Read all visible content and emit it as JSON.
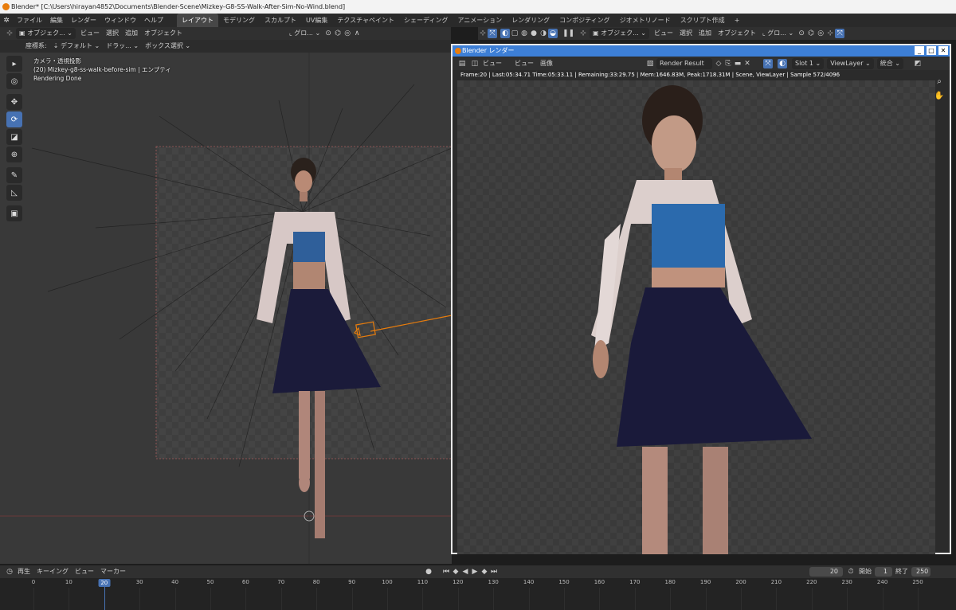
{
  "window": {
    "title": "Blender* [C:\\Users\\hirayan4852\\Documents\\Blender-Scene\\Mizkey-G8-SS-Walk-After-Sim-No-Wind.blend]"
  },
  "menu": [
    "ファイル",
    "編集",
    "レンダー",
    "ウィンドウ",
    "ヘルプ"
  ],
  "workspaces": [
    "レイアウト",
    "モデリング",
    "スカルプト",
    "UV編集",
    "テクスチャペイント",
    "シェーディング",
    "アニメーション",
    "レンダリング",
    "コンポジティング",
    "ジオメトリノード",
    "スクリプト作成",
    "+"
  ],
  "viewport_header": {
    "mode": "オブジェク...",
    "items": [
      "ビュー",
      "選択",
      "追加",
      "オブジェクト"
    ],
    "transform": "グロ...",
    "coords_label": "座標系:",
    "coords_value": "デフォルト",
    "drag_value": "ドラッ...",
    "select_mode": "ボックス選択"
  },
  "right_header": {
    "mode": "オブジェク...",
    "items": [
      "ビュー",
      "選択",
      "追加",
      "オブジェクト"
    ],
    "transform": "グロ..."
  },
  "viewport_overlay": {
    "line1": "カメラ・透視投影",
    "line2": "(20) Mizkey-g8-ss-walk-before-sim | エンプティ",
    "line3": "Rendering Done"
  },
  "render_window": {
    "title": "Blender レンダー",
    "menu": [
      "ビュー",
      "ビュー",
      "画像"
    ],
    "image_name": "Render Result",
    "slot": "Slot 1",
    "view_layer": "ViewLayer",
    "pass": "統合",
    "stats": "Frame:20 | Last:05:34.71 Time:05:33.11 | Remaining:33:29.75 | Mem:1646.83M, Peak:1718.31M | Scene, ViewLayer | Sample 572/4096"
  },
  "timeline_header": {
    "items": [
      "再生",
      "キーイング",
      "ビュー",
      "マーカー"
    ],
    "current_frame": "20",
    "start_label": "開始",
    "start": "1",
    "end_label": "終了",
    "end": "250"
  },
  "timeline": {
    "ticks": [
      "0",
      "10",
      "20",
      "30",
      "40",
      "50",
      "60",
      "70",
      "80",
      "90",
      "100",
      "110",
      "120",
      "130",
      "140",
      "150",
      "160",
      "170",
      "180",
      "190",
      "200",
      "210",
      "220",
      "230",
      "240",
      "250"
    ],
    "current": 20
  },
  "colors": {
    "accent": "#4772b3",
    "orange": "#e87d0d",
    "title_blue": "#3d7fd6"
  }
}
